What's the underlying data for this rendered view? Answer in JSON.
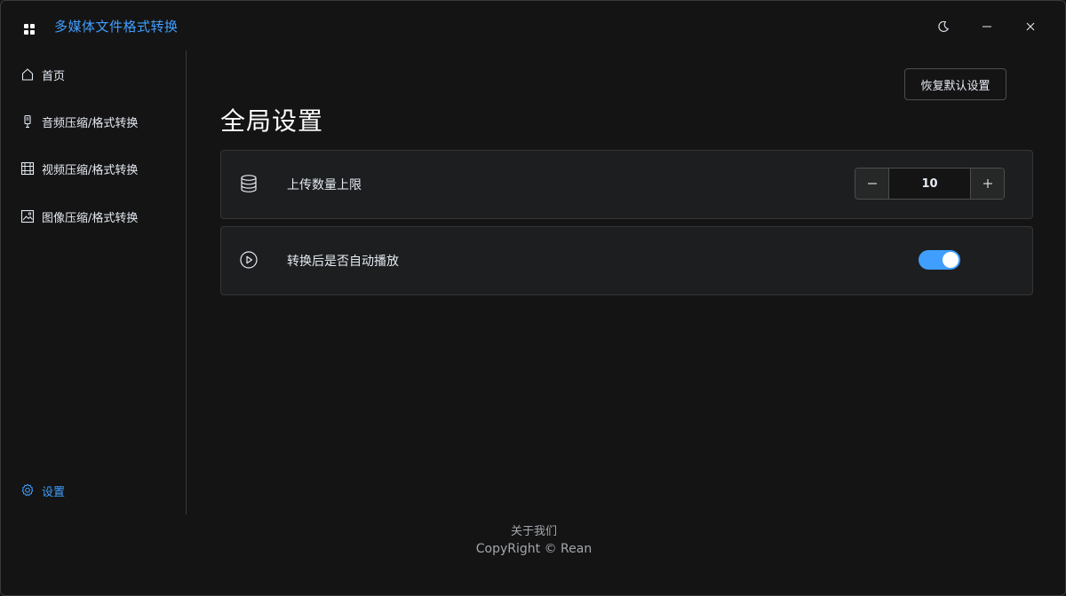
{
  "app": {
    "title": "多媒体文件格式转换",
    "icon": "grid-icon",
    "accent_color": "#409eff"
  },
  "window_controls": {
    "theme": "moon-icon",
    "minimize": "minimize-icon",
    "close": "close-icon"
  },
  "sidebar": {
    "items": [
      {
        "label": "首页",
        "icon": "home-icon"
      },
      {
        "label": "音频压缩/格式转换",
        "icon": "microphone-icon"
      },
      {
        "label": "视频压缩/格式转换",
        "icon": "film-icon"
      },
      {
        "label": "图像压缩/格式转换",
        "icon": "image-icon"
      }
    ],
    "settings": {
      "label": "设置",
      "icon": "gear-icon",
      "active": true
    }
  },
  "main": {
    "restore_button": "恢复默认设置",
    "title": "全局设置",
    "settings": [
      {
        "label": "上传数量上限",
        "icon": "database-icon",
        "control": "stepper",
        "value": "10"
      },
      {
        "label": "转换后是否自动播放",
        "icon": "play-circle-icon",
        "control": "toggle",
        "enabled": true
      }
    ]
  },
  "footer": {
    "about": "关于我们",
    "copyright": "CopyRight © Rean"
  }
}
